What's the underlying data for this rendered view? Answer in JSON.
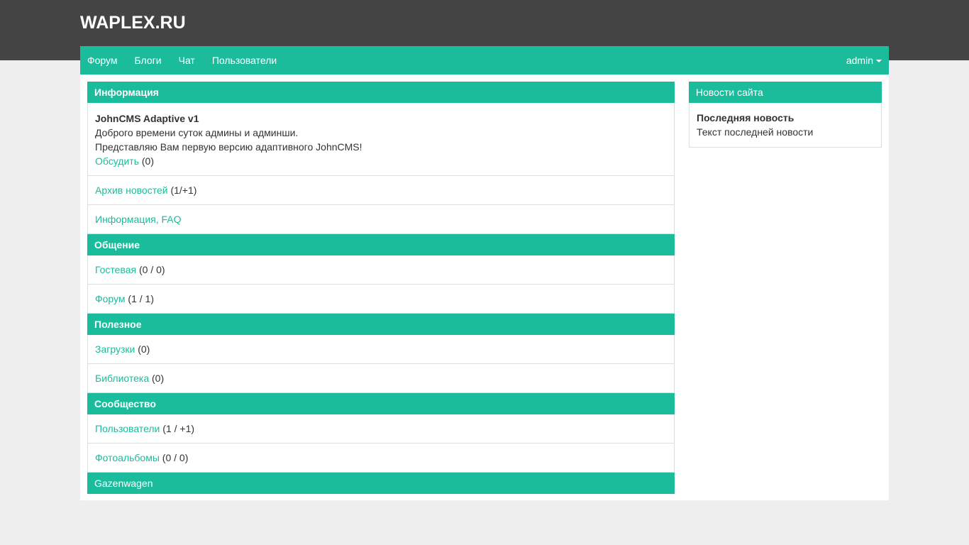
{
  "site_title": "WAPLEX.RU",
  "nav": {
    "items": [
      "Форум",
      "Блоги",
      "Чат",
      "Пользователи"
    ],
    "user": "admin"
  },
  "info": {
    "header": "Информация",
    "title": "JohnCMS Adaptive v1",
    "line1": "Доброго времени суток админы и админши.",
    "line2": "Представляю Вам первую версию адаптивного JohnCMS!",
    "discuss": "Обсудить",
    "discuss_count": "(0)",
    "archive": "Архив новостей",
    "archive_count": "(1/+1)",
    "faq": "Информация, FAQ"
  },
  "communication": {
    "header": "Общение",
    "guest": "Гостевая",
    "guest_count": "(0 / 0)",
    "forum": "Форум",
    "forum_count": "(1 / 1)"
  },
  "useful": {
    "header": "Полезное",
    "downloads": "Загрузки",
    "downloads_count": "(0)",
    "library": "Библиотека",
    "library_count": "(0)"
  },
  "community": {
    "header": "Сообщество",
    "users": "Пользователи",
    "users_count": "(1 / +1)",
    "albums": "Фотоальбомы",
    "albums_count": "(0 / 0)"
  },
  "extra": {
    "header": "Gazenwagen"
  },
  "news": {
    "header": "Новости сайта",
    "title": "Последняя новость",
    "text": "Текст последней новости"
  }
}
